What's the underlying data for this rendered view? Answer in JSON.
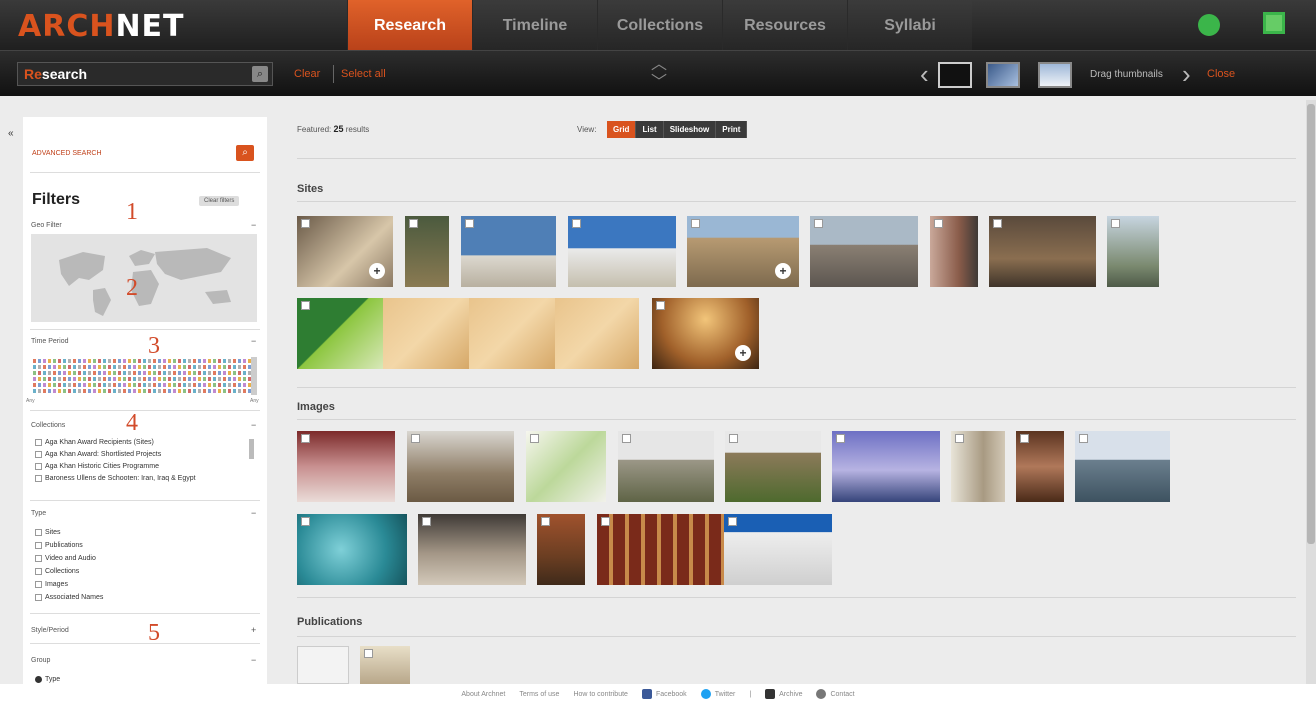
{
  "logo": {
    "part1": "ARCH",
    "part2": "NET"
  },
  "nav": {
    "tabs": [
      "Research",
      "Timeline",
      "Collections",
      "Resources",
      "Syllabi"
    ],
    "active": "Research"
  },
  "toolbar": {
    "search_prefix": "Re",
    "search_rest": "search",
    "clear": "Clear",
    "select_all": "Select all",
    "drag_thumbnails": "Drag thumbnails",
    "close": "Close"
  },
  "sidebar": {
    "advanced_search": "ADVANCED SEARCH",
    "filters_title": "Filters",
    "clear_filters": "Clear filters",
    "geo_filter": "Geo Filter",
    "time_period": "Time Period",
    "time_left": "Any",
    "time_right": "Any",
    "collections": {
      "label": "Collections",
      "items": [
        "Aga Khan Award Recipients (Sites)",
        "Aga Khan Award: Shortlisted Projects",
        "Aga Khan Historic Cities Programme",
        "Baroness Ullens de Schooten: Iran, Iraq & Egypt"
      ]
    },
    "type": {
      "label": "Type",
      "items": [
        "Sites",
        "Publications",
        "Video and Audio",
        "Collections",
        "Images",
        "Associated Names"
      ]
    },
    "style_period": "Style/Period",
    "group": {
      "label": "Group",
      "option": "Type"
    },
    "annotations": [
      "1",
      "2",
      "3",
      "4",
      "5"
    ]
  },
  "main": {
    "featured_prefix": "Featured:",
    "featured_count": "25",
    "featured_suffix": "results",
    "view_label": "View:",
    "view_buttons": [
      "Grid",
      "List",
      "Slideshow",
      "Print"
    ],
    "active_view": "Grid",
    "sections": {
      "sites": "Sites",
      "images": "Images",
      "publications": "Publications"
    }
  },
  "footer": {
    "links": [
      "About Archnet",
      "Terms of use",
      "How to contribute",
      "Facebook",
      "Twitter",
      "|",
      "Archive",
      "Contact"
    ]
  },
  "colors": {
    "accent": "#d9531e",
    "topbar": "#2b2b2b",
    "background": "#ececec",
    "annotation": "#d24b2a"
  }
}
